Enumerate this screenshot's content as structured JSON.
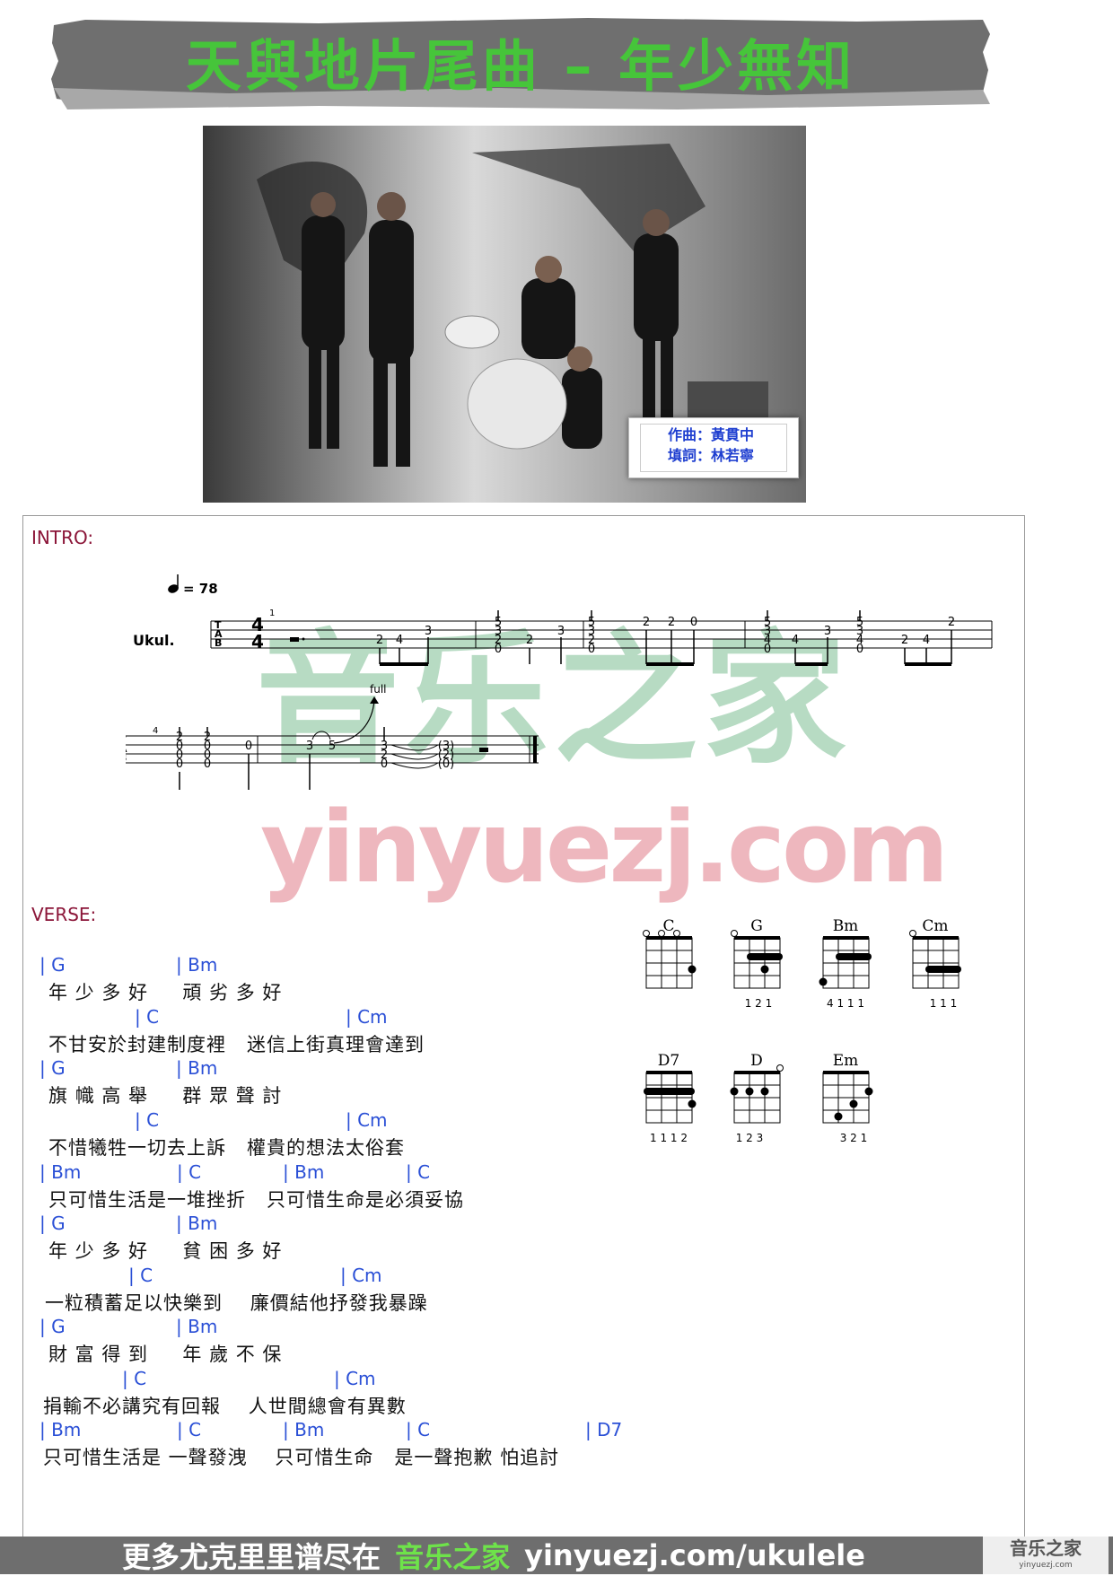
{
  "title": "天與地片尾曲 – 年少無知",
  "credits": {
    "composer": "作曲：黃貫中",
    "lyricist": "填詞：林若寧"
  },
  "watermarks": {
    "cn": "音乐之家",
    "en": "yinyuezj.com"
  },
  "intro": {
    "label": "INTRO:",
    "tempo": "= 78",
    "instrument": "Ukul.",
    "measure1": "1",
    "measure4": "4",
    "bend": "full",
    "tab_row1_frets": [
      "2",
      "4",
      "3",
      "5",
      "3",
      "2",
      "0",
      "2",
      "3",
      "5",
      "3",
      "2",
      "0",
      "2",
      "2",
      "0",
      "5",
      "3",
      "4",
      "0",
      "4",
      "3",
      "5",
      "3",
      "4",
      "0",
      "2",
      "4",
      "2"
    ],
    "tab_row2_frets": [
      "2",
      "0",
      "0",
      "0",
      "2",
      "0",
      "0",
      "0",
      "0",
      "3",
      "5",
      "3",
      "2",
      "0",
      "(3)",
      "(2)",
      "(0)"
    ]
  },
  "verse": {
    "label": "VERSE:",
    "lines": [
      {
        "chords": [
          "| G",
          "| Bm"
        ],
        "lyric": "年 少 多 好     頑 劣 多 好"
      },
      {
        "chords": [
          "| C",
          "| Cm"
        ],
        "lyric": "不甘安於封建制度裡   迷信上街真理會達到"
      },
      {
        "chords": [
          "| G",
          "| Bm"
        ],
        "lyric": "旗 幟 高 舉     群 眾 聲 討"
      },
      {
        "chords": [
          "| C",
          "| Cm"
        ],
        "lyric": "不惜犧牲一切去上訴   權貴的想法太俗套"
      },
      {
        "chords": [
          "| Bm",
          "| C",
          "| Bm",
          "| C"
        ],
        "lyric": "只可惜生活是一堆挫折   只可惜生命是必須妥協"
      },
      {
        "chords": [
          "| G",
          "| Bm"
        ],
        "lyric": "年 少 多 好     貧 困 多 好"
      },
      {
        "chords": [
          "| C",
          "| Cm"
        ],
        "lyric": "一粒積蓄足以快樂到    廉價結他抒發我暴躁"
      },
      {
        "chords": [
          "| G",
          "| Bm"
        ],
        "lyric": "財 富 得 到     年 歲 不 保"
      },
      {
        "chords": [
          "| C",
          "| Cm"
        ],
        "lyric": "捐輸不必講究有回報    人世間總會有異數"
      },
      {
        "chords": [
          "| Bm",
          "| C",
          "| Bm",
          "| C",
          "| D7"
        ],
        "lyric": "只可惜生活是 一聲發洩    只可惜生命   是一聲抱歉 怕追討"
      }
    ]
  },
  "chord_diagrams": [
    {
      "name": "C",
      "fingers": ""
    },
    {
      "name": "G",
      "fingers": "1 2 1"
    },
    {
      "name": "Bm",
      "fingers": "4 1 1 1"
    },
    {
      "name": "Cm",
      "fingers": "1 1 1"
    },
    {
      "name": "D7",
      "fingers": "1 1 1 2"
    },
    {
      "name": "D",
      "fingers": "1 2 3"
    },
    {
      "name": "Em",
      "fingers": "3 2 1"
    }
  ],
  "footer": {
    "text1": "更多尤克里里谱尽在",
    "brand": "音乐之家",
    "url": "yinyuezj.com/ukulele",
    "logo": "音乐之家",
    "logo_url": "yinyuezj.com"
  }
}
